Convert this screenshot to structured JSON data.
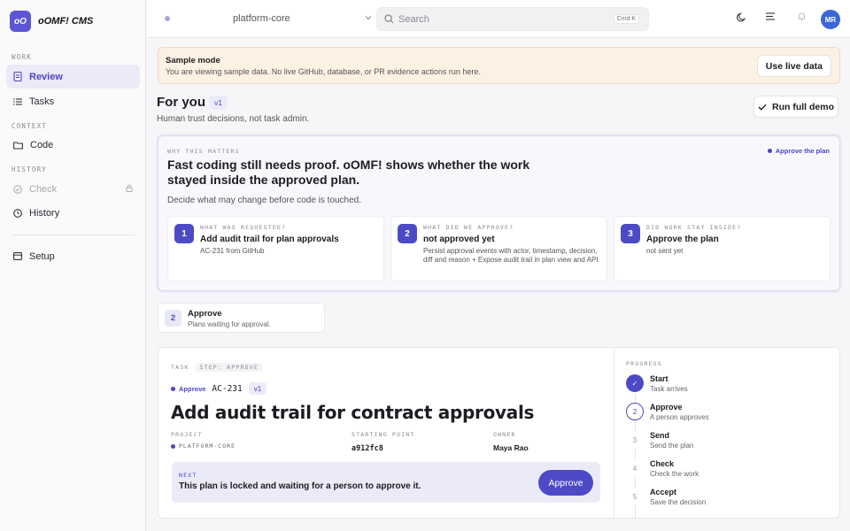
{
  "brand": {
    "logo_text": "oO",
    "name": "oOMF! CMS"
  },
  "sidebar": {
    "sections": [
      {
        "label": "WORK"
      },
      {
        "label": "CONTEXT"
      },
      {
        "label": "HISTORY"
      }
    ],
    "items": [
      {
        "label": "Review",
        "icon": "document-icon",
        "active": true
      },
      {
        "label": "Tasks",
        "icon": "list-icon"
      },
      {
        "label": "Code",
        "icon": "folder-icon"
      },
      {
        "label": "Check",
        "icon": "check-circle-icon",
        "disabled": true,
        "locked": true
      },
      {
        "label": "History",
        "icon": "clock-icon"
      },
      {
        "label": "Setup",
        "icon": "setup-icon"
      }
    ]
  },
  "topbar": {
    "project": "platform-core",
    "search_placeholder": "Search",
    "search_shortcut": "Cmd K",
    "avatar_initials": "MR"
  },
  "banner": {
    "title": "Sample mode",
    "text": "You are viewing sample data. No live GitHub, database, or PR evidence actions run here.",
    "button": "Use live data"
  },
  "header": {
    "title": "For you",
    "version": "v1",
    "subtitle": "Human trust decisions, not task admin.",
    "run_demo": "Run full demo"
  },
  "why": {
    "eyebrow": "WHY THIS MATTERS",
    "headline": "Fast coding still needs proof. oOMF! shows whether the work stayed inside the approved plan.",
    "sub": "Decide what may change before code is touched.",
    "status": "Approve the plan",
    "steps": [
      {
        "num": "1",
        "eyebrow": "WHAT WAS REQUESTED?",
        "title": "Add audit trail for plan approvals",
        "desc": "AC-231 from GitHub"
      },
      {
        "num": "2",
        "eyebrow": "WHAT DID WE APPROVE?",
        "title": "not approved yet",
        "desc": "Persist approval events with actor, timestamp, decision, diff and reason + Expose audit trail in plan view and API"
      },
      {
        "num": "3",
        "eyebrow": "DID WORK STAY INSIDE?",
        "title": "Approve the plan",
        "desc": "not sent yet"
      }
    ]
  },
  "approve_chip": {
    "num": "2",
    "title": "Approve",
    "sub": "Plans waiting for approval."
  },
  "task": {
    "eyebrow": "TASK",
    "step_tag": "STEP: APPROVE",
    "status": "Approve",
    "id": "AC-231",
    "version": "v1",
    "title": "Add audit trail for contract approvals",
    "fields": {
      "project_label": "PROJECT",
      "project_value": "PLATFORM-CORE",
      "start_label": "STARTING POINT",
      "start_value": "a912fc8",
      "owner_label": "OWNER",
      "owner_value": "Maya Rao"
    },
    "next": {
      "eyebrow": "NEXT",
      "text": "This plan is locked and waiting for a person to approve it.",
      "button": "Approve"
    }
  },
  "progress": {
    "eyebrow": "PROGRESS",
    "steps": [
      {
        "num": "✓",
        "title": "Start",
        "sub": "Task arrives",
        "state": "done"
      },
      {
        "num": "2",
        "title": "Approve",
        "sub": "A person approves",
        "state": "current"
      },
      {
        "num": "3",
        "title": "Send",
        "sub": "Send the plan",
        "state": "todo"
      },
      {
        "num": "4",
        "title": "Check",
        "sub": "Check the work",
        "state": "todo"
      },
      {
        "num": "5",
        "title": "Accept",
        "sub": "Save the decision",
        "state": "todo"
      }
    ]
  },
  "colors": {
    "accent": "#4d4ac6",
    "banner_bg": "#fdf1e4",
    "avatar": "#3a66d6"
  }
}
